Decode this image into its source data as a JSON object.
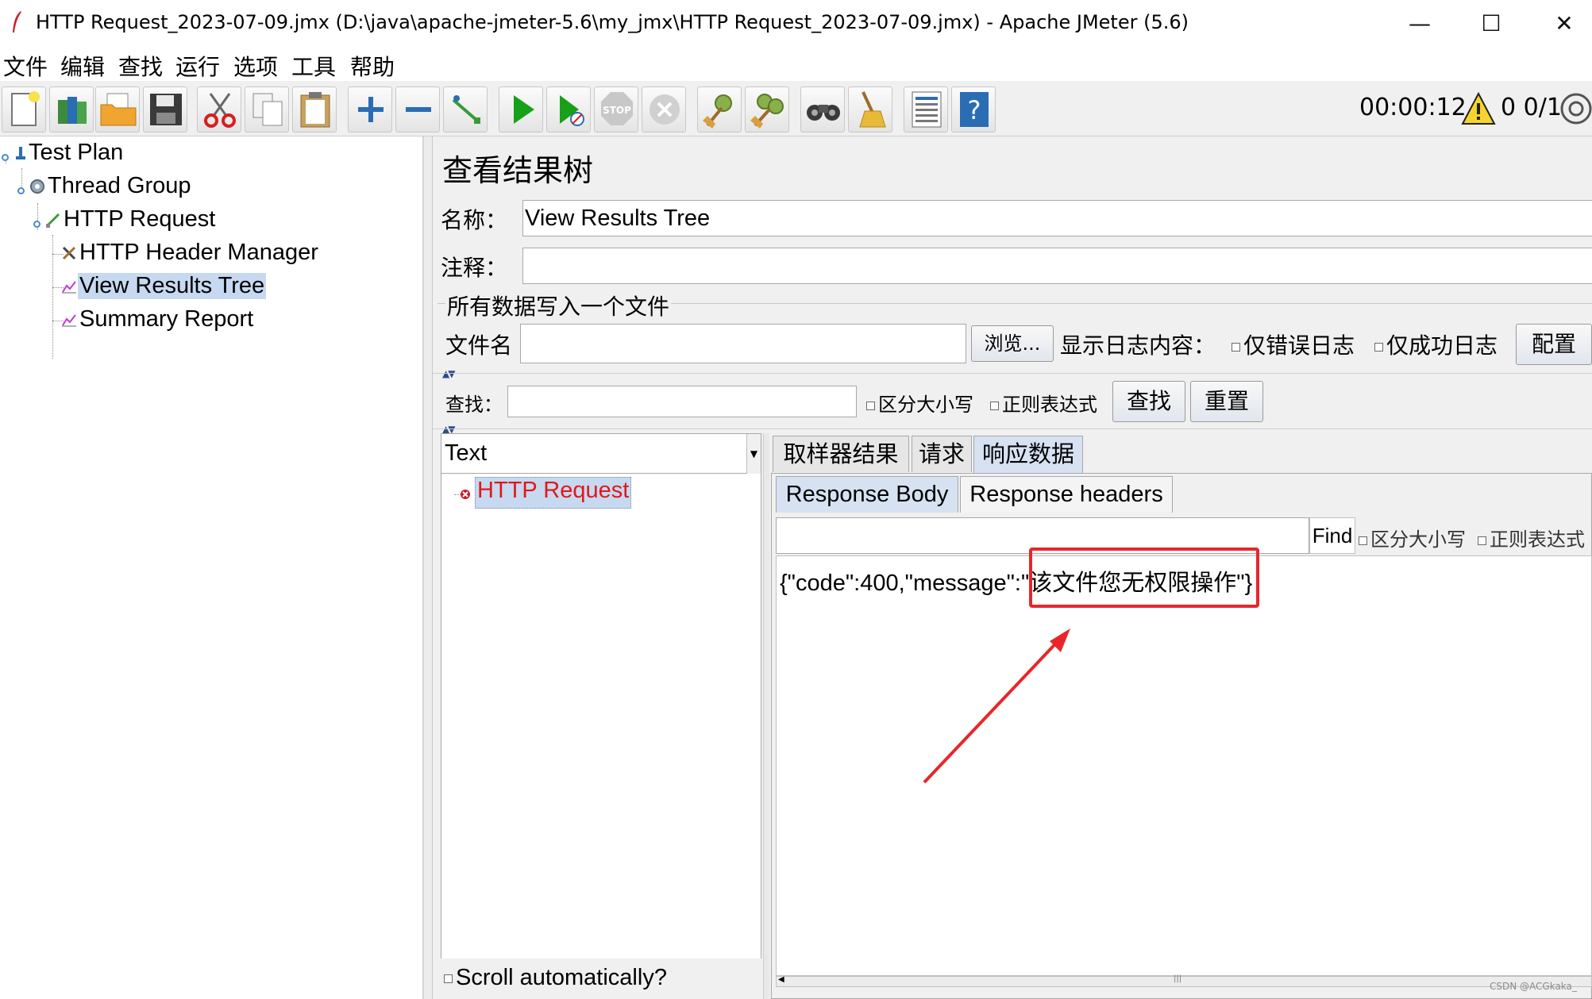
{
  "window": {
    "title": "HTTP Request_2023-07-09.jmx (D:\\java\\apache-jmeter-5.6\\my_jmx\\HTTP Request_2023-07-09.jmx) - Apache JMeter (5.6)",
    "controls": {
      "minimize": "—",
      "maximize": "☐",
      "close": "✕"
    }
  },
  "menu": [
    "文件",
    "编辑",
    "查找",
    "运行",
    "选项",
    "工具",
    "帮助"
  ],
  "toolbar": {
    "buttons": [
      {
        "name": "new",
        "icon": "new-document-icon"
      },
      {
        "name": "templates",
        "icon": "templates-icon"
      },
      {
        "name": "open",
        "icon": "open-folder-icon"
      },
      {
        "name": "save",
        "icon": "save-floppy-icon"
      },
      {
        "name": "cut",
        "icon": "scissors-icon"
      },
      {
        "name": "copy",
        "icon": "copy-icon"
      },
      {
        "name": "paste",
        "icon": "paste-clipboard-icon"
      },
      {
        "name": "expand",
        "icon": "plus-icon"
      },
      {
        "name": "collapse",
        "icon": "minus-icon"
      },
      {
        "name": "toggle",
        "icon": "toggle-wand-icon"
      },
      {
        "name": "start",
        "icon": "play-icon"
      },
      {
        "name": "start-no-pause",
        "icon": "play-no-timers-icon"
      },
      {
        "name": "stop",
        "icon": "stop-icon"
      },
      {
        "name": "shutdown",
        "icon": "shutdown-icon"
      },
      {
        "name": "clear",
        "icon": "broom-gear-icon"
      },
      {
        "name": "clear-all",
        "icon": "broom-gears-icon"
      },
      {
        "name": "search",
        "icon": "binoculars-icon"
      },
      {
        "name": "reset-search",
        "icon": "broom-icon"
      },
      {
        "name": "function-helper",
        "icon": "function-list-icon"
      },
      {
        "name": "help",
        "icon": "help-icon"
      }
    ],
    "timer": "00:00:12",
    "warning_count": "0",
    "threads": "0/1"
  },
  "tree": [
    {
      "label": "Test Plan",
      "level": 0,
      "icon": "test-plan-icon"
    },
    {
      "label": "Thread Group",
      "level": 1,
      "icon": "thread-group-gear-icon"
    },
    {
      "label": "HTTP Request",
      "level": 2,
      "icon": "sampler-pen-icon"
    },
    {
      "label": "HTTP Header Manager",
      "level": 3,
      "icon": "header-manager-icon"
    },
    {
      "label": "View Results Tree",
      "level": 3,
      "icon": "listener-chart-icon",
      "selected": true
    },
    {
      "label": "Summary Report",
      "level": 3,
      "icon": "listener-chart-icon"
    }
  ],
  "panel": {
    "heading": "查看结果树",
    "name_label": "名称：",
    "name_value": "View Results Tree",
    "comment_label": "注释：",
    "comment_value": "",
    "file_section_title": "所有数据写入一个文件",
    "filename_label": "文件名",
    "filename_value": "",
    "browse_button": "浏览...",
    "log_label": "显示日志内容：",
    "errors_only": "仅错误日志",
    "success_only": "仅成功日志",
    "configure_button": "配置",
    "search_label": "查找：",
    "search_value": "",
    "case_sensitive": "区分大小写",
    "regex": "正则表达式",
    "find_button": "查找",
    "reset_button": "重置"
  },
  "results": {
    "renderer": "Text",
    "items": [
      {
        "label": "HTTP Request",
        "status": "error"
      }
    ],
    "scroll_auto": "Scroll automatically?"
  },
  "detail": {
    "tabs": [
      "取样器结果",
      "请求",
      "响应数据"
    ],
    "active_tab": "响应数据",
    "subtabs": [
      "Response Body",
      "Response headers"
    ],
    "active_subtab": "Response Body",
    "find_value": "",
    "find_button": "Find",
    "case_sensitive": "区分大小写",
    "regex": "正则表达式",
    "response_prefix": "{\"code\":400,\"message\":\"",
    "response_highlight": "该文件您无权限操作",
    "response_suffix": "\"}",
    "annotation_color": "#e8262a"
  },
  "watermark": "CSDN @ACGkaka_"
}
